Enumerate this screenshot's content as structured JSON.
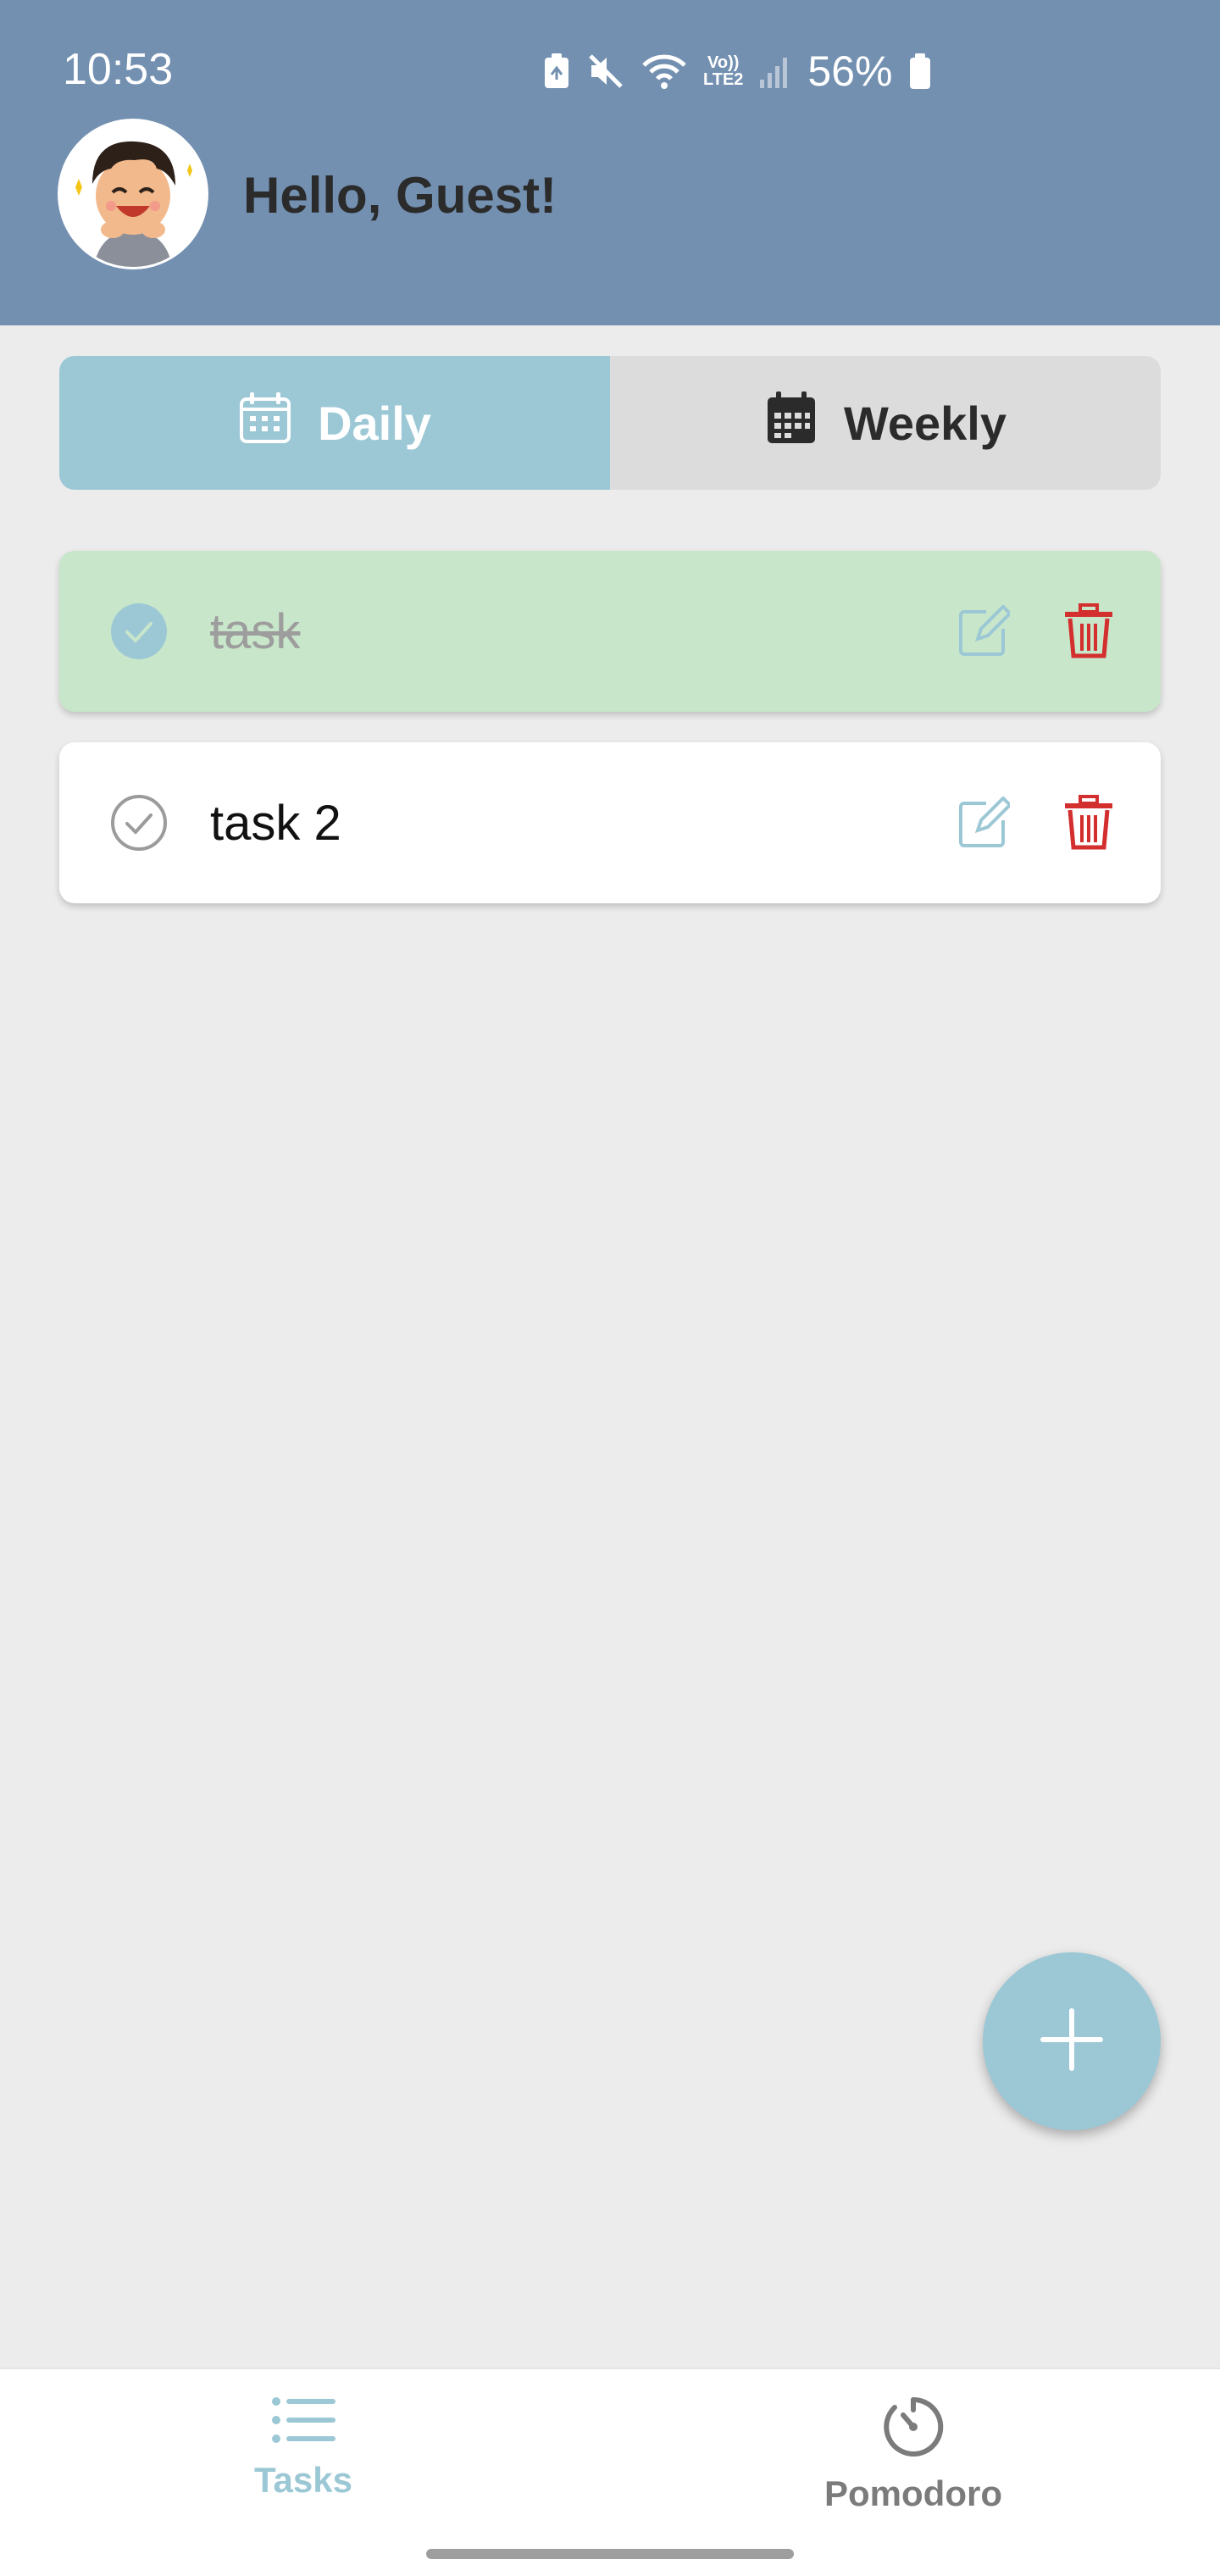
{
  "status_bar": {
    "time": "10:53",
    "vol_label_top": "Vo))",
    "vol_label_bottom": "LTE2",
    "battery": "56%"
  },
  "header": {
    "greeting": "Hello, Guest!",
    "color": "#7390b1"
  },
  "tabs": [
    {
      "label": "Daily",
      "icon": "calendar-outline-icon",
      "selected": true
    },
    {
      "label": "Weekly",
      "icon": "calendar-filled-icon",
      "selected": false
    }
  ],
  "tasks": [
    {
      "text": "task",
      "completed": true
    },
    {
      "text": "task 2",
      "completed": false
    }
  ],
  "fab": {
    "icon": "plus-icon"
  },
  "bottom_nav": [
    {
      "label": "Tasks",
      "icon": "list-icon",
      "active": true
    },
    {
      "label": "Pomodoro",
      "icon": "timer-icon",
      "active": false
    }
  ],
  "colors": {
    "accent": "#9cc8d6",
    "done_bg": "#c8e6c9",
    "delete": "#d32f2f",
    "background": "#ececec"
  }
}
